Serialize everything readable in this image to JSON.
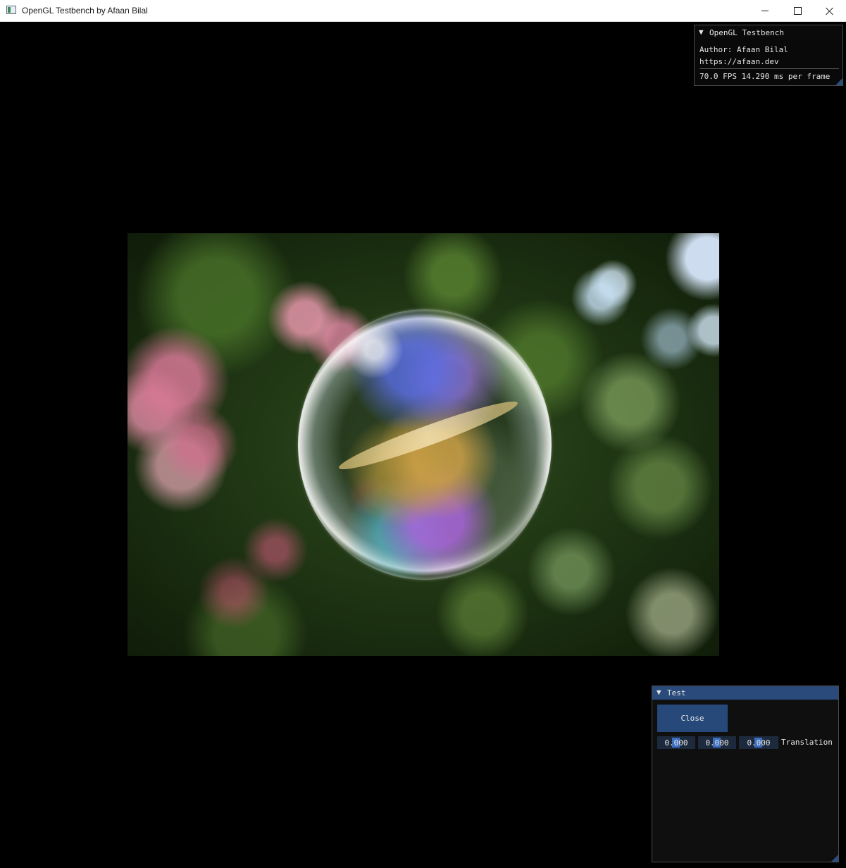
{
  "window": {
    "title": "OpenGL Testbench by Afaan Bilal"
  },
  "overlay": {
    "arrow": "▼",
    "title": "OpenGL Testbench",
    "author": "Author: Afaan Bilal",
    "url": "https://afaan.dev",
    "fps": "70.0 FPS 14.290 ms per frame"
  },
  "test_window": {
    "arrow": "▼",
    "title": "Test",
    "close_label": "Close",
    "translation": [
      "0.000",
      "0.000",
      "0.000"
    ],
    "translation_label": "Translation"
  },
  "colors": {
    "imgui_header_active": "#294a7a",
    "imgui_button": "#26497a",
    "imgui_frame": "#1d2a3d",
    "imgui_grab": "#3d6fc0",
    "window_bg": "#0f0f0f",
    "viewport_bg": "#000000"
  }
}
